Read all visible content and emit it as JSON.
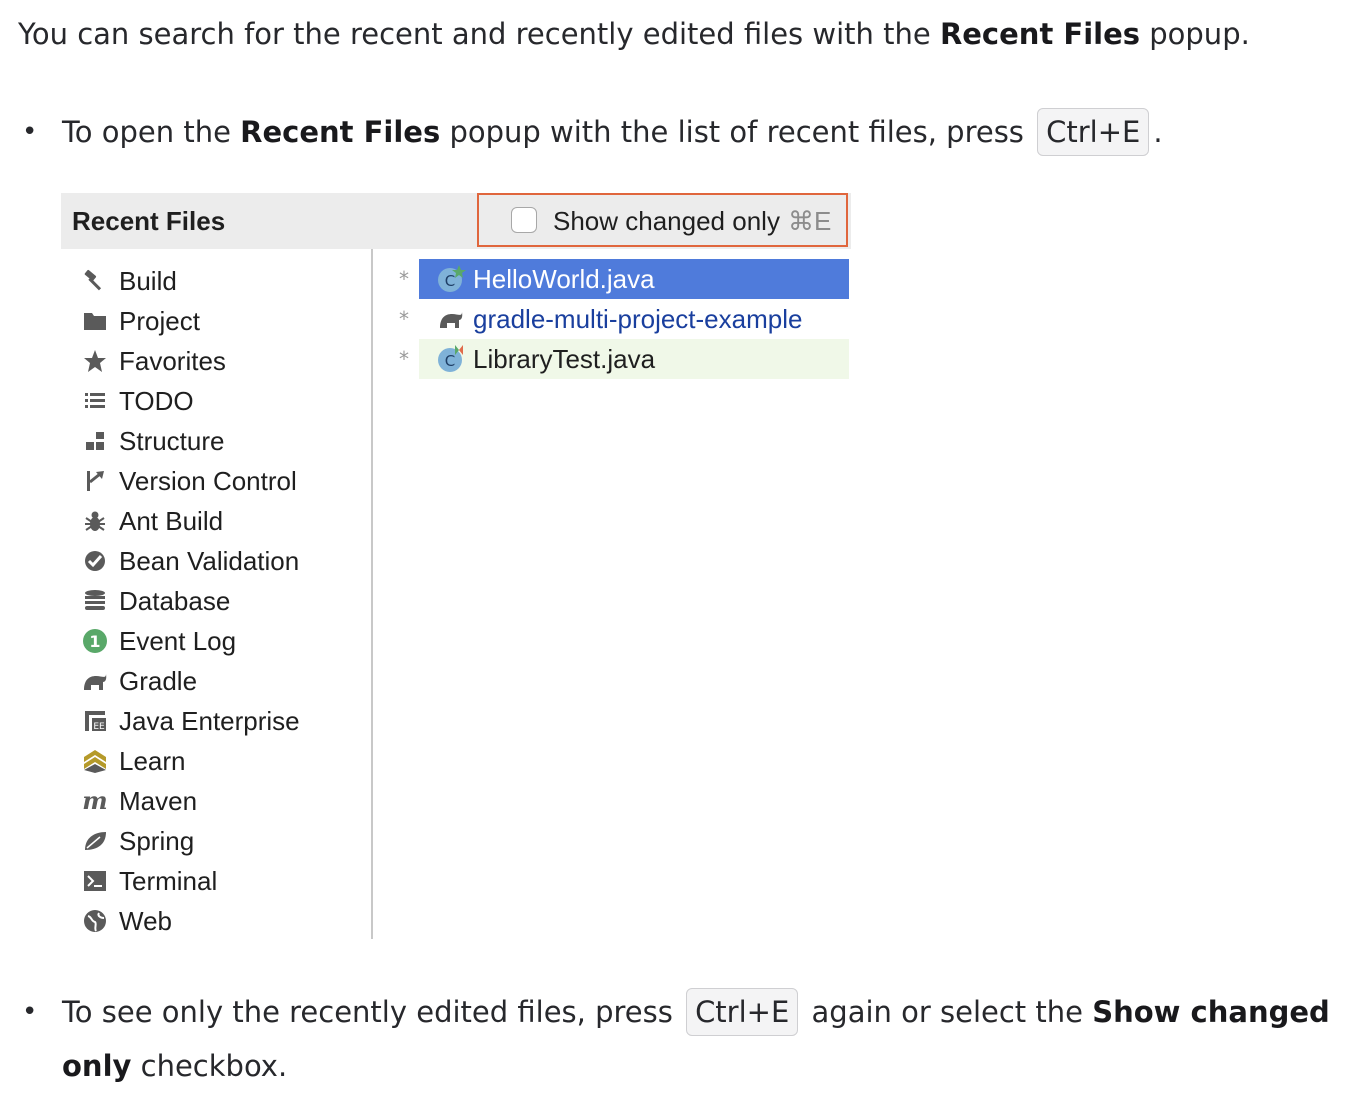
{
  "intro": {
    "before": "You can search for the recent and recently edited files with the ",
    "bold": "Recent Files",
    "after": " popup."
  },
  "bullet1": {
    "before": "To open the ",
    "bold": "Recent Files",
    "middle": " popup with the list of recent files, press ",
    "shortcut": "Ctrl+E",
    "after": "."
  },
  "popup": {
    "title": "Recent Files",
    "show_changed_label": "Show changed only",
    "show_changed_shortcut": "⌘E",
    "show_changed_checked": false,
    "highlight_color": "#e0663d",
    "tool_windows": [
      {
        "label": "Build",
        "icon": "hammer-icon"
      },
      {
        "label": "Project",
        "icon": "folder-icon"
      },
      {
        "label": "Favorites",
        "icon": "star-icon"
      },
      {
        "label": "TODO",
        "icon": "list-icon"
      },
      {
        "label": "Structure",
        "icon": "structure-icon"
      },
      {
        "label": "Version Control",
        "icon": "vcs-branch-icon"
      },
      {
        "label": "Ant Build",
        "icon": "ant-icon"
      },
      {
        "label": "Bean Validation",
        "icon": "bean-validation-icon"
      },
      {
        "label": "Database",
        "icon": "database-icon"
      },
      {
        "label": "Event Log",
        "icon": "event-log-badge-icon"
      },
      {
        "label": "Gradle",
        "icon": "gradle-elephant-icon"
      },
      {
        "label": "Java Enterprise",
        "icon": "java-ee-icon"
      },
      {
        "label": "Learn",
        "icon": "learn-chevron-icon"
      },
      {
        "label": "Maven",
        "icon": "maven-m-icon"
      },
      {
        "label": "Spring",
        "icon": "spring-leaf-icon"
      },
      {
        "label": "Terminal",
        "icon": "terminal-icon"
      },
      {
        "label": "Web",
        "icon": "globe-icon"
      }
    ],
    "files": [
      {
        "marker": "*",
        "label": "HelloWorld.java",
        "icon": "java-class-icon",
        "state": "selected"
      },
      {
        "marker": "*",
        "label": "gradle-multi-project-example",
        "icon": "gradle-elephant-icon",
        "state": "link"
      },
      {
        "marker": "*",
        "label": "LibraryTest.java",
        "icon": "java-test-class-icon",
        "state": "green"
      }
    ]
  },
  "bullet2": {
    "before": "To see only the recently edited files, press ",
    "shortcut": "Ctrl+E",
    "middle": " again or select the ",
    "bold": "Show changed only",
    "after": " checkbox."
  }
}
